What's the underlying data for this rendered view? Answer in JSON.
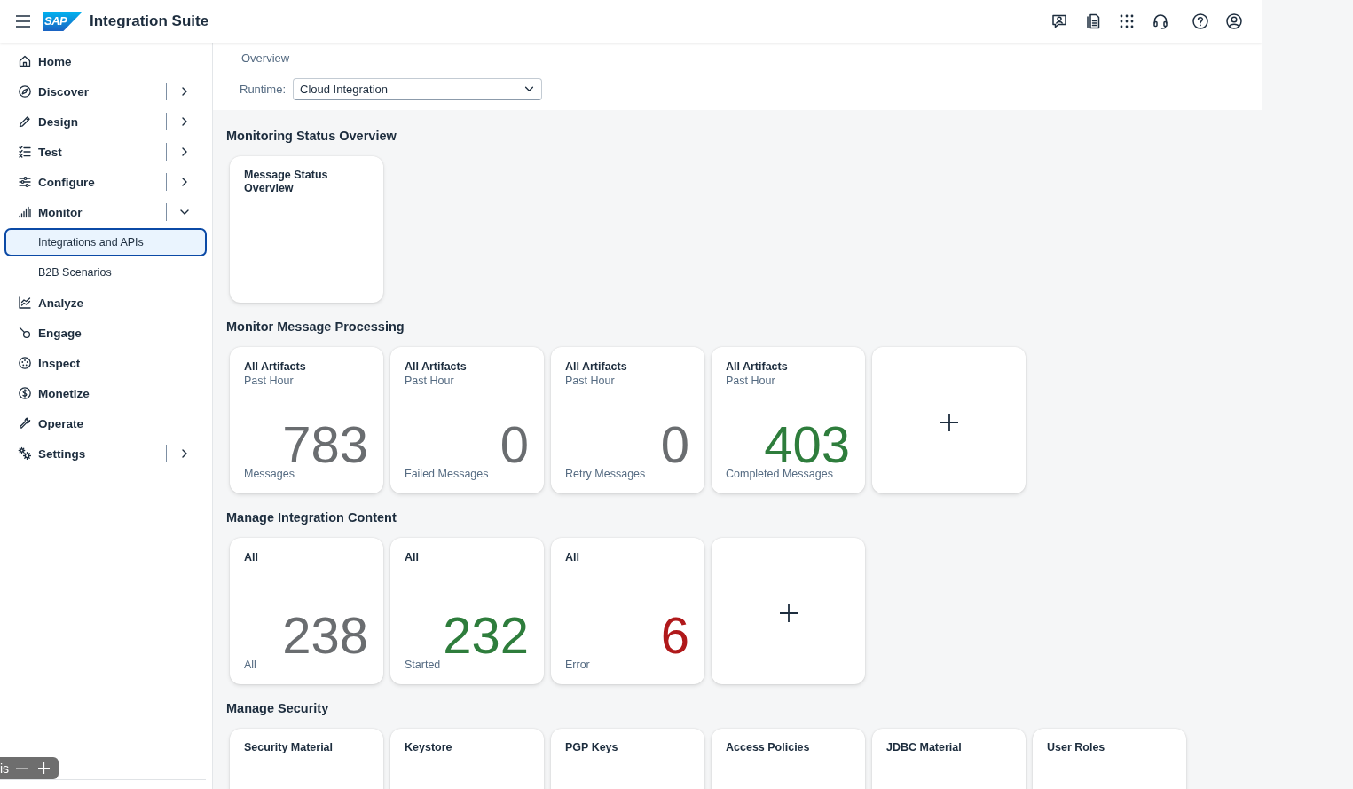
{
  "shell": {
    "logo": "SAP",
    "title": "Integration Suite"
  },
  "navigation": [
    {
      "kind": "link",
      "label": "Home",
      "selected": false
    },
    {
      "kind": "group",
      "label": "Discover",
      "selected": false,
      "expanded": false
    },
    {
      "kind": "group",
      "label": "Design",
      "selected": false,
      "expanded": false
    },
    {
      "kind": "group",
      "label": "Test",
      "selected": false,
      "expanded": false
    },
    {
      "kind": "group",
      "label": "Configure",
      "selected": false,
      "expanded": false
    },
    {
      "kind": "group",
      "label": "Monitor",
      "selected": false,
      "expanded": true,
      "children": [
        {
          "label": "Integrations and APIs",
          "selected": true
        },
        {
          "label": "B2B Scenarios",
          "selected": false
        }
      ]
    },
    {
      "kind": "link",
      "label": "Analyze",
      "selected": false
    },
    {
      "kind": "link",
      "label": "Engage",
      "selected": false
    },
    {
      "kind": "link",
      "label": "Inspect",
      "selected": false
    },
    {
      "kind": "link",
      "label": "Monetize",
      "selected": false
    },
    {
      "kind": "link",
      "label": "Operate",
      "selected": false
    },
    {
      "kind": "group",
      "label": "Settings",
      "selected": false,
      "expanded": false
    }
  ],
  "page": {
    "breadcrumb": "Overview",
    "runtime": {
      "label": "Runtime:",
      "value": "Cloud Integration"
    }
  },
  "sections": [
    {
      "title": "Monitoring Status Overview",
      "tiles": [
        {
          "kind": "launch",
          "title": "Message Status Overview"
        }
      ]
    },
    {
      "title": "Monitor Message Processing",
      "tiles": [
        {
          "kind": "numeric",
          "title": "All Artifacts",
          "subtitle": "Past Hour",
          "value": "783",
          "footer": "Messages",
          "color": "#6a6d70"
        },
        {
          "kind": "numeric",
          "title": "All Artifacts",
          "subtitle": "Past Hour",
          "value": "0",
          "footer": "Failed Messages",
          "color": "#6a6d70"
        },
        {
          "kind": "numeric",
          "title": "All Artifacts",
          "subtitle": "Past Hour",
          "value": "0",
          "footer": "Retry Messages",
          "color": "#6a6d70"
        },
        {
          "kind": "numeric",
          "title": "All Artifacts",
          "subtitle": "Past Hour",
          "value": "403",
          "footer": "Completed Messages",
          "color": "#2e7d3c"
        },
        {
          "kind": "add"
        }
      ]
    },
    {
      "title": "Manage Integration Content",
      "tiles": [
        {
          "kind": "numeric",
          "title": "All",
          "value": "238",
          "footer": "All",
          "color": "#6a6d70"
        },
        {
          "kind": "numeric",
          "title": "All",
          "value": "232",
          "footer": "Started",
          "color": "#2e7d3c"
        },
        {
          "kind": "numeric",
          "title": "All",
          "value": "6",
          "footer": "Error",
          "color": "#b0191b"
        },
        {
          "kind": "add"
        }
      ]
    },
    {
      "title": "Manage Security",
      "tiles": [
        {
          "kind": "launch",
          "title": "Security Material"
        },
        {
          "kind": "launch",
          "title": "Keystore"
        },
        {
          "kind": "launch",
          "title": "PGP Keys"
        },
        {
          "kind": "launch",
          "title": "Access Policies"
        },
        {
          "kind": "launch",
          "title": "JDBC Material"
        },
        {
          "kind": "launch",
          "title": "User Roles"
        }
      ]
    }
  ],
  "zoom_control": {
    "label": "is"
  }
}
